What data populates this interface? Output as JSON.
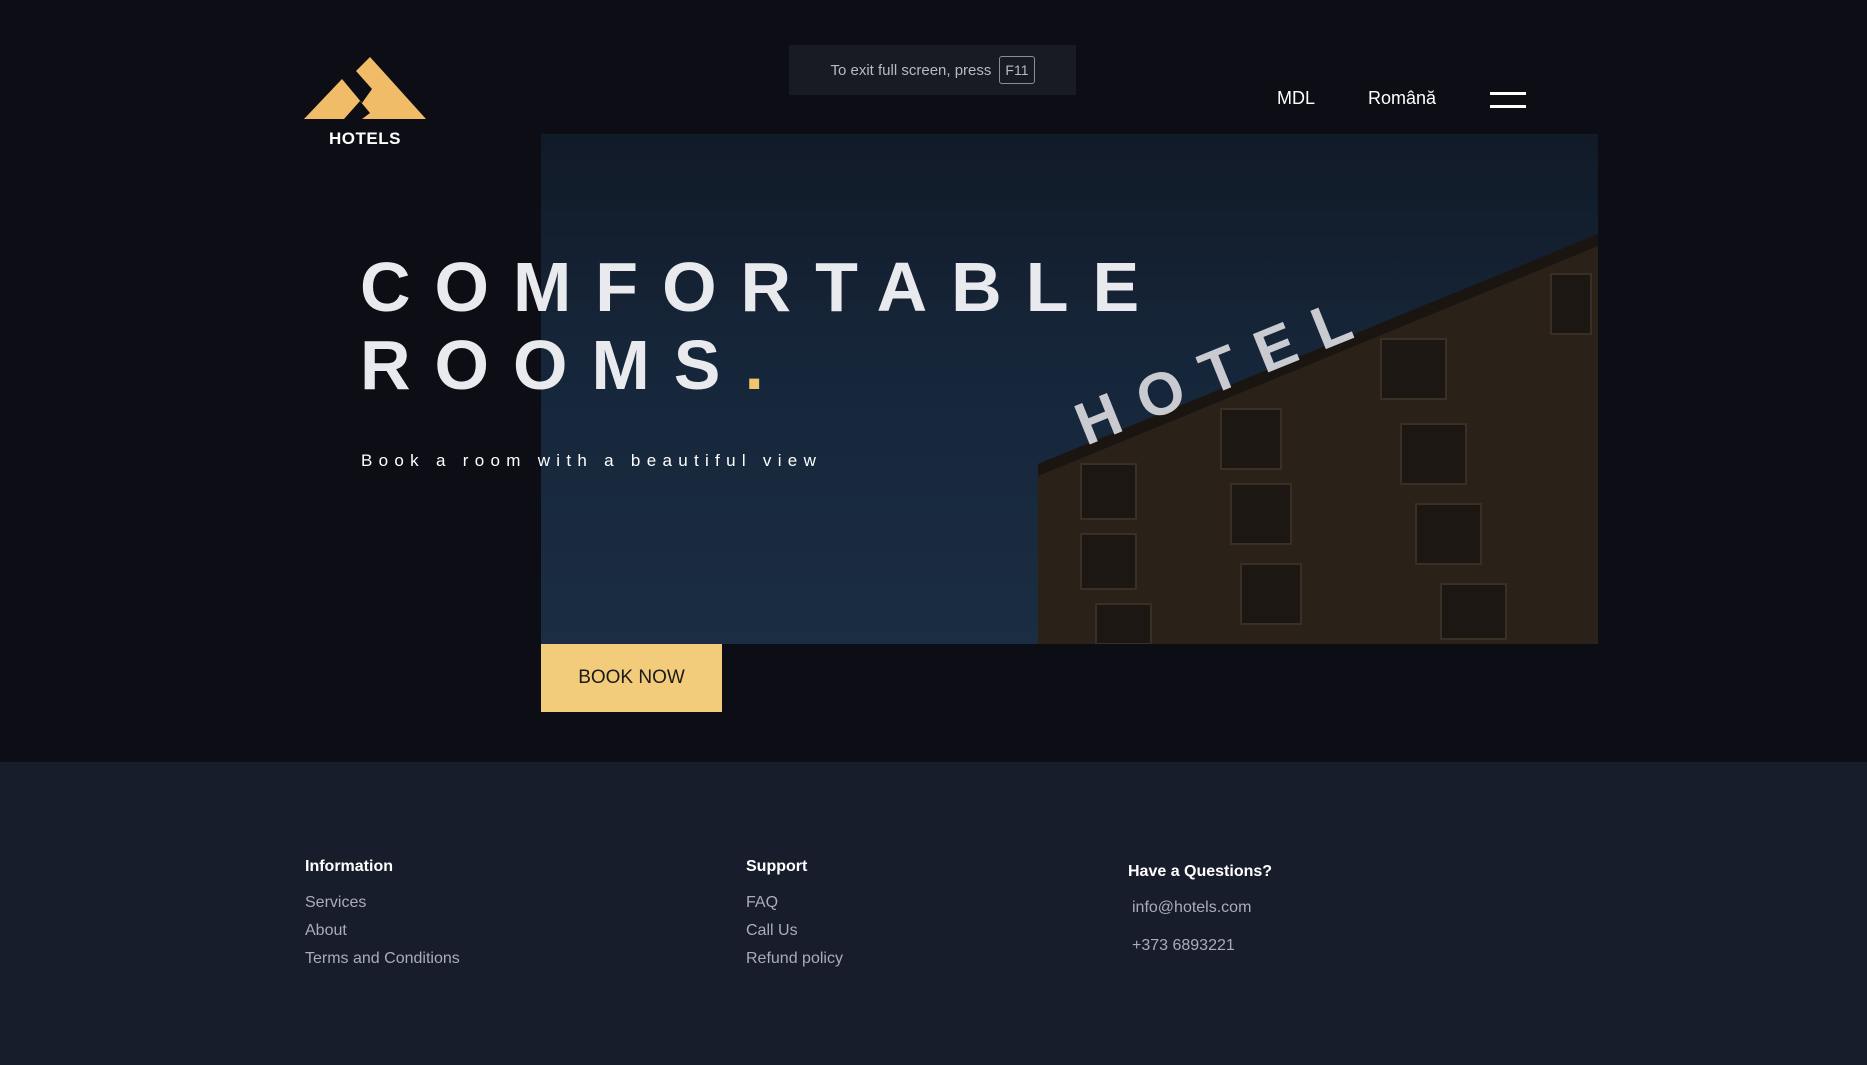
{
  "brand": {
    "name": "HOTELS",
    "colors": {
      "accent": "#f2cc7a",
      "background": "#0c0d15",
      "footer": "#181d2b"
    }
  },
  "fullscreen_notice": {
    "text": "To exit full screen, press",
    "key": "F11"
  },
  "nav": {
    "currency": "MDL",
    "language": "Română",
    "menu_icon": "hamburger-icon"
  },
  "hero": {
    "headline_line1": "COMFORTABLE",
    "headline_line2": "ROOMS",
    "headline_dot": ".",
    "subtitle": "Book a room with a beautiful view",
    "sign_text": "HOTEL",
    "cta": "BOOK NOW"
  },
  "footer": {
    "information": {
      "title": "Information",
      "links": [
        "Services",
        "About",
        "Terms and Conditions"
      ]
    },
    "support": {
      "title": "Support",
      "links": [
        "FAQ",
        "Call Us",
        "Refund policy"
      ]
    },
    "contact": {
      "title": "Have a Questions?",
      "email": "info@hotels.com",
      "phone": "+373 6893221"
    }
  }
}
